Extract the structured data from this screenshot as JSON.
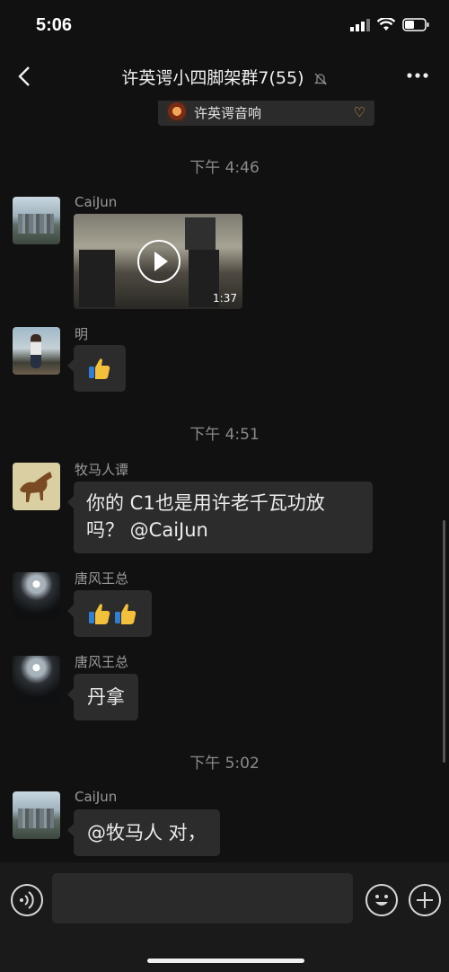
{
  "status_bar": {
    "time": "5:06"
  },
  "header": {
    "title": "许英谔小四脚架群7(55)"
  },
  "pinned": {
    "name": "许英谔音响"
  },
  "messages": [
    {
      "type": "time",
      "text": "下午 4:46"
    },
    {
      "sender": "CaiJun",
      "type": "video",
      "duration": "1:37"
    },
    {
      "sender": "明",
      "type": "emoji",
      "emoji": [
        "thumbs-up"
      ]
    },
    {
      "type": "time",
      "text": "下午 4:51"
    },
    {
      "sender": "牧马人谭",
      "type": "text",
      "lines": [
        "你的 C1也是用许老千瓦功放",
        "吗？ @CaiJun"
      ]
    },
    {
      "sender": "唐风王总",
      "type": "emoji",
      "emoji": [
        "thumbs-up",
        "thumbs-up"
      ]
    },
    {
      "sender": "唐风王总",
      "type": "text",
      "text": "丹拿"
    },
    {
      "type": "time",
      "text": "下午 5:02"
    },
    {
      "sender": "CaiJun",
      "type": "text",
      "text": "@牧马人 对，"
    }
  ],
  "input": {
    "placeholder": ""
  },
  "colors": {
    "background": "#111111",
    "bubble": "#2c2c2c",
    "muted_text": "#8a8a8a",
    "accent": "#e4a444"
  }
}
